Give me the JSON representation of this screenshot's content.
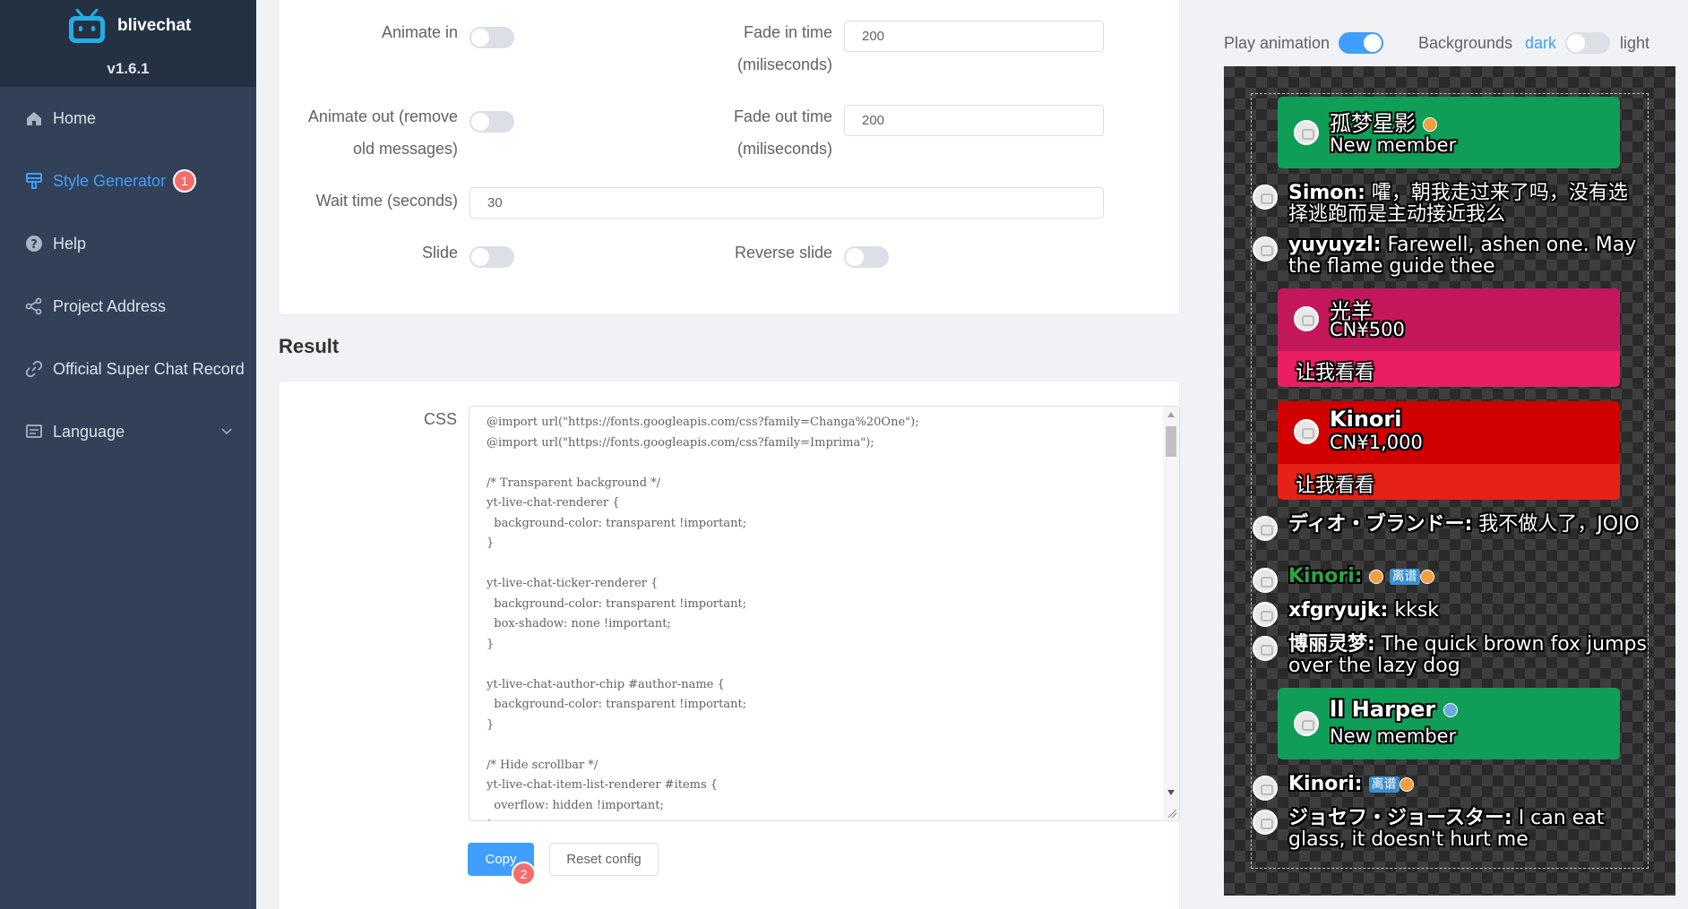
{
  "sidebar": {
    "brand": "blivechat",
    "version": "v1.6.1",
    "items": [
      {
        "label": "Home"
      },
      {
        "label": "Style Generator",
        "badge": "1"
      },
      {
        "label": "Help"
      },
      {
        "label": "Project Address"
      },
      {
        "label": "Official Super Chat Record"
      },
      {
        "label": "Language"
      }
    ]
  },
  "settings": {
    "animate_in": "Animate in",
    "fade_in_time_1": "Fade in time",
    "fade_in_time_2": "(miliseconds)",
    "fade_in_value": "200",
    "animate_out_1": "Animate out (remove",
    "animate_out_2": "old messages)",
    "fade_out_time_1": "Fade out time",
    "fade_out_time_2": "(miliseconds)",
    "fade_out_value": "200",
    "wait_time": "Wait time (seconds)",
    "wait_time_value": "30",
    "slide": "Slide",
    "reverse_slide": "Reverse slide"
  },
  "result": {
    "title": "Result",
    "css_label": "CSS",
    "code": "@import url(\"https://fonts.googleapis.com/css?family=Changa%20One\");\n@import url(\"https://fonts.googleapis.com/css?family=Imprima\");\n\n/* Transparent background */\nyt-live-chat-renderer {\n  background-color: transparent !important;\n}\n\nyt-live-chat-ticker-renderer {\n  background-color: transparent !important;\n  box-shadow: none !important;\n}\n\nyt-live-chat-author-chip #author-name {\n  background-color: transparent !important;\n}\n\n/* Hide scrollbar */\nyt-live-chat-item-list-renderer #items {\n  overflow: hidden !important;\n}",
    "copy": "Copy",
    "copy_badge": "2",
    "reset": "Reset config"
  },
  "preview": {
    "play_animation": "Play animation",
    "backgrounds": "Backgrounds",
    "dark": "dark",
    "light": "light"
  },
  "chat": {
    "m1_name": "孤梦星影",
    "m1_sub": "New member",
    "c1_author": "Simon:",
    "c1_text": " 嚯，朝我走过来了吗，没有选择逃跑而是主动接近我么",
    "c2_author": "yuyuyzl:",
    "c2_text": " Farewell, ashen one. May the flame guide thee",
    "p1_name": "光羊",
    "p1_amount": "CN¥500",
    "p1_msg": "让我看看",
    "p2_name": "Kinori",
    "p2_amount": "CN¥1,000",
    "p2_msg": "让我看看",
    "c3_author": "ディオ・ブランドー:",
    "c3_text": " 我不做人了，JOJO",
    "c4_author": "Kinori:",
    "c4_medal": "离谱",
    "c5_author": "xfgryujk:",
    "c5_text": " kksk",
    "c6_author": "博丽灵梦:",
    "c6_text": " The quick brown fox jumps over the lazy dog",
    "m2_name": "ll Harper",
    "m2_sub": "New member",
    "c7_author": "Kinori:",
    "c7_medal": "离谱",
    "c8_author": "ジョセフ・ジョースター:",
    "c8_text": " I can eat glass, it doesn't hurt me"
  }
}
